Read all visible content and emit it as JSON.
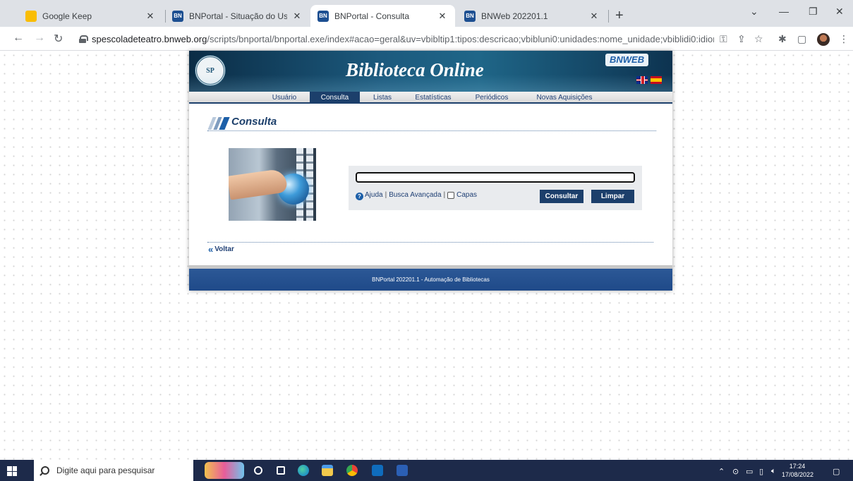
{
  "browser": {
    "tabs": [
      {
        "title": "Google Keep",
        "icon": "google-keep-icon",
        "color": "#f9bd05",
        "active": false
      },
      {
        "title": "BNPortal - Situação do Usuário",
        "icon": "bnportal-icon",
        "color": "#1d4f91",
        "active": false
      },
      {
        "title": "BNPortal - Consulta",
        "icon": "bnportal-icon",
        "color": "#1d4f91",
        "active": true
      },
      {
        "title": "BNWeb 202201.1",
        "icon": "bnweb-icon",
        "color": "#1d4f91",
        "active": false
      }
    ],
    "url_host": "spescoladeteatro.bnweb.org",
    "url_path": "/scripts/bnportal/bnportal.exe/index#acao=geral&uv=vbibltip1:tipos:descricao;vbibluni0:unidades:nome_unidade;vbiblidi0:idiom..."
  },
  "portal": {
    "seal_text": "SP",
    "title": "Biblioteca Online",
    "logo": "BNWEB",
    "menu": [
      {
        "label": "Usuário",
        "active": false
      },
      {
        "label": "Consulta",
        "active": true
      },
      {
        "label": "Listas",
        "active": false
      },
      {
        "label": "Estatísticas",
        "active": false
      },
      {
        "label": "Periódicos",
        "active": false
      },
      {
        "label": "Novas Aquisições",
        "active": false
      }
    ],
    "section_title": "Consulta",
    "search": {
      "value": "",
      "help_label": "Ajuda",
      "advanced_label": "Busca Avançada",
      "covers_label": "Capas",
      "submit_label": "Consultar",
      "clear_label": "Limpar"
    },
    "back_label": "Voltar",
    "footer": "BNPortal 202201.1 - Automação de Bibliotecas"
  },
  "taskbar": {
    "search_placeholder": "Digite aqui para pesquisar",
    "time": "17:24",
    "date": "17/08/2022"
  },
  "colors": {
    "nav_blue": "#1c3f6b",
    "footer_blue": "#2c5896"
  }
}
